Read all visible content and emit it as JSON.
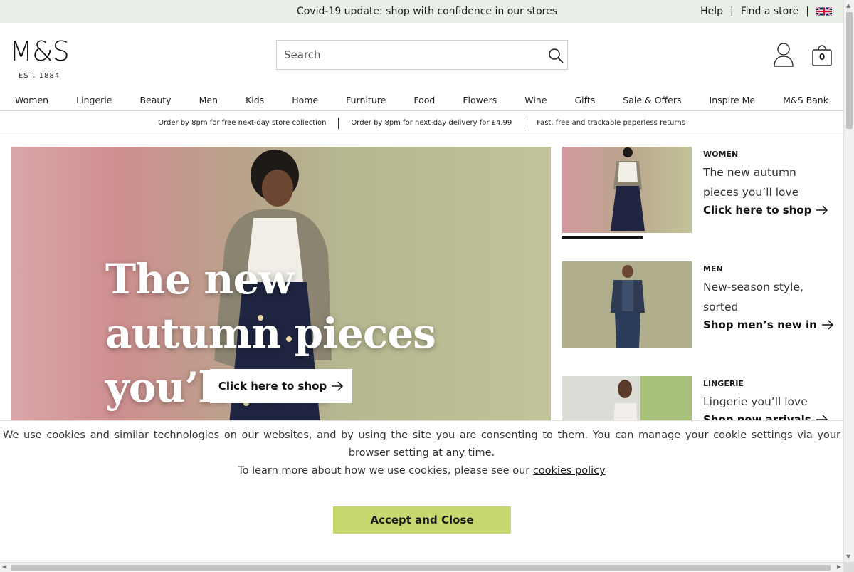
{
  "promo_bar": {
    "message": "Covid-19 update: shop with confidence in our stores",
    "help": "Help",
    "separator": "|",
    "find_store": "Find a store",
    "flag_icon": "uk-flag-icon"
  },
  "header": {
    "logo_text": "M&S",
    "logo_est": "EST. 1884",
    "search_placeholder": "Search",
    "search_icon": "search-icon",
    "account_icon": "account-icon",
    "bag_icon": "shopping-bag-icon",
    "bag_count": "0"
  },
  "nav": {
    "items": [
      "Women",
      "Lingerie",
      "Beauty",
      "Men",
      "Kids",
      "Home",
      "Furniture",
      "Food",
      "Flowers",
      "Wine",
      "Gifts",
      "Sale & Offers",
      "Inspire Me",
      "M&S Bank"
    ]
  },
  "delivery_strip": {
    "items": [
      "Order by 8pm for free next-day store collection",
      "Order by 8pm for next-day delivery for £4.99",
      "Fast, free and trackable paperless returns"
    ]
  },
  "hero": {
    "headline": "The new autumn pieces you’ll love",
    "cta": "Click here to shop",
    "cta_icon": "arrow-right-icon"
  },
  "side_promos": [
    {
      "category": "WOMEN",
      "title": "The new autumn pieces you’ll love",
      "link": "Click here to shop"
    },
    {
      "category": "MEN",
      "title": "New-season style, sorted",
      "link": "Shop men’s new in"
    },
    {
      "category": "LINGERIE",
      "title": "Lingerie you’ll love",
      "link": "Shop new arrivals"
    }
  ],
  "cookie_banner": {
    "text1": "We use cookies and similar technologies on our websites, and by using the site you are consenting to them. You can manage your cookie settings via your browser setting at any time.",
    "text2": "To learn more about how we use cookies, please see our",
    "policy_link": "cookies policy",
    "accept_button": "Accept and Close",
    "accept_color": "#c5d86d"
  },
  "colors": {
    "promo_bar_bg": "#e7efe7",
    "accent_green": "#c5d86d"
  }
}
